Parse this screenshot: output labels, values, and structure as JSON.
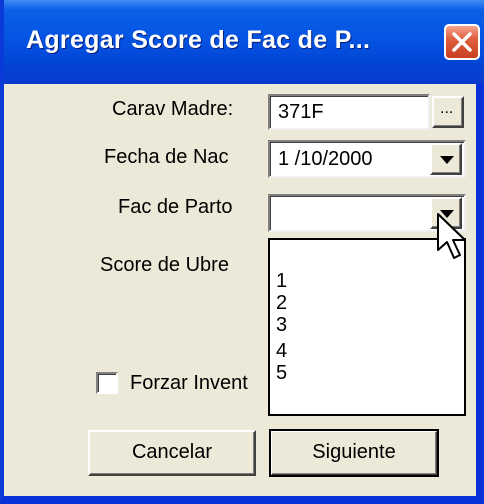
{
  "window": {
    "title": "Agregar Score de Fac de P...",
    "close_icon": "close-icon"
  },
  "form": {
    "carav_madre": {
      "label": "Carav Madre:",
      "value": "371F",
      "browse_label": "..."
    },
    "fecha_de_nac": {
      "label": "Fecha de Nac",
      "value": "1 /10/2000"
    },
    "fac_de_parto": {
      "label": "Fac de Parto",
      "value": ""
    },
    "score_de_ubre": {
      "label": "Score de Ubre"
    },
    "forzar": {
      "label": "Forzar Invent",
      "checked": false
    }
  },
  "dropdown": {
    "options": [
      "1",
      "2",
      "3",
      "4",
      "5"
    ]
  },
  "buttons": {
    "cancel_label": "Cancelar",
    "next_label": "Siguiente"
  },
  "colors": {
    "title_bar": "#0554e3",
    "dialog_bg": "#ece9d8",
    "close_button": "#e0603f"
  }
}
